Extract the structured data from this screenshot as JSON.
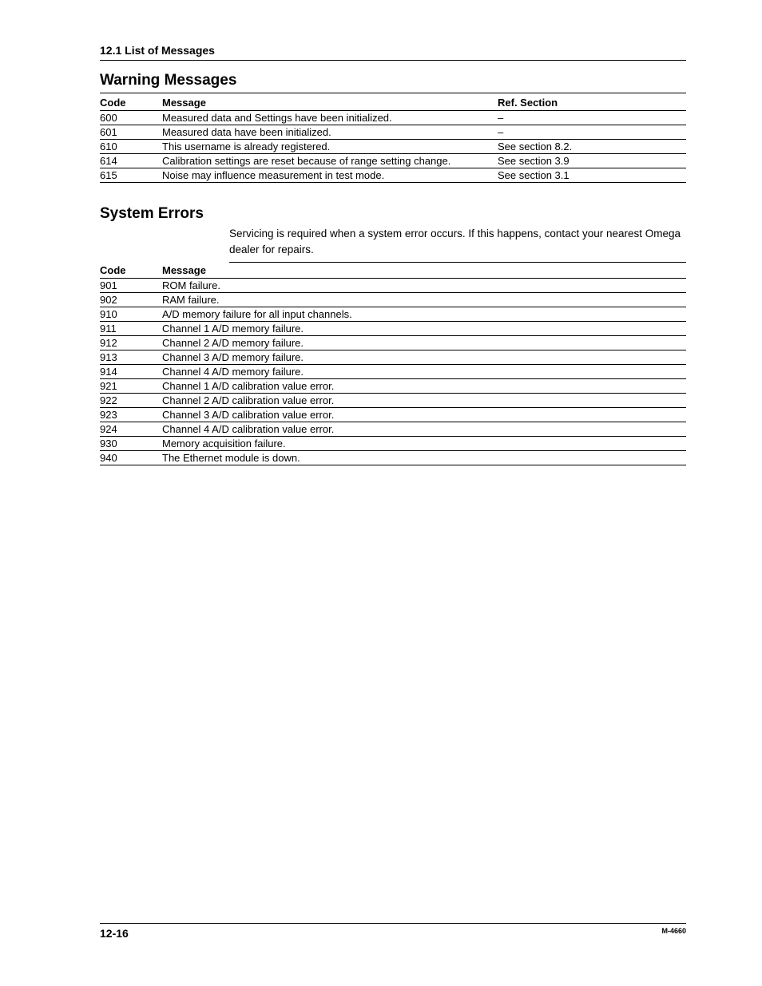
{
  "section_header": "12.1  List of Messages",
  "warning": {
    "heading": "Warning Messages",
    "columns": {
      "code": "Code",
      "message": "Message",
      "ref": "Ref. Section"
    },
    "rows": [
      {
        "code": "600",
        "message": "Measured data and Settings have been initialized.",
        "ref": "–"
      },
      {
        "code": "601",
        "message": "Measured data have been initialized.",
        "ref": "–"
      },
      {
        "code": "610",
        "message": "This username is already registered.",
        "ref": "See section 8.2."
      },
      {
        "code": "614",
        "message": "Calibration settings are reset because of range setting change.",
        "ref": "See section 3.9"
      },
      {
        "code": "615",
        "message": "Noise may influence measurement in test mode.",
        "ref": "See section 3.1"
      }
    ]
  },
  "system": {
    "heading": "System Errors",
    "intro": "Servicing is required when a system error occurs. If this happens, contact your nearest Omega dealer for repairs.",
    "columns": {
      "code": "Code",
      "message": "Message"
    },
    "rows": [
      {
        "code": "901",
        "message": "ROM failure."
      },
      {
        "code": "902",
        "message": "RAM failure."
      },
      {
        "code": "910",
        "message": "A/D memory failure for all input channels."
      },
      {
        "code": "911",
        "message": "Channel 1 A/D memory failure."
      },
      {
        "code": "912",
        "message": "Channel 2 A/D memory failure."
      },
      {
        "code": "913",
        "message": "Channel 3 A/D memory failure."
      },
      {
        "code": "914",
        "message": "Channel 4 A/D memory failure."
      },
      {
        "code": "921",
        "message": "Channel 1 A/D calibration value error."
      },
      {
        "code": "922",
        "message": "Channel 2 A/D calibration value error."
      },
      {
        "code": "923",
        "message": "Channel 3 A/D calibration value error."
      },
      {
        "code": "924",
        "message": "Channel 4 A/D calibration value error."
      },
      {
        "code": "930",
        "message": "Memory acquisition failure."
      },
      {
        "code": "940",
        "message": "The Ethernet module is down."
      }
    ]
  },
  "footer": {
    "page_number": "12-16",
    "doc_id": "M-4660"
  }
}
